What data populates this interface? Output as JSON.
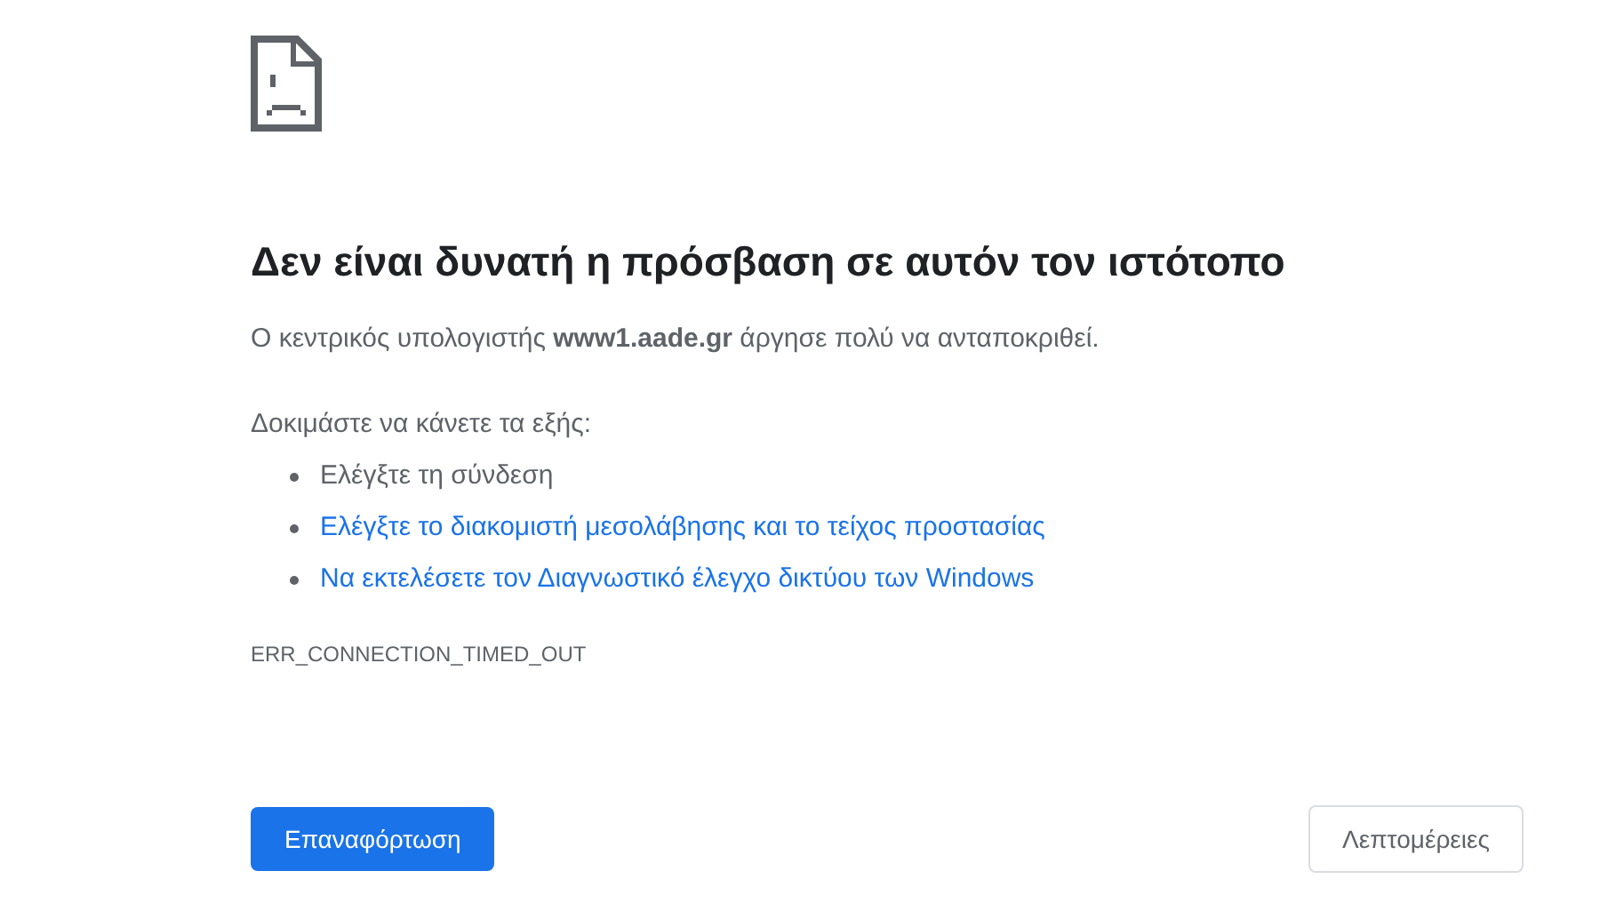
{
  "heading": "Δεν είναι δυνατή η πρόσβαση σε αυτόν τον ιστότοπο",
  "message": "Ο κεντρικός υπολογιστής **www1.aade.gr** άργησε πολύ να ανταποκριθεί.",
  "suggestions_intro": "Δοκιμάστε να κάνετε τα εξής:",
  "suggestions": [
    {
      "kind": "text",
      "label": "Ελέγξτε τη σύνδεση"
    },
    {
      "kind": "link",
      "label": "Ελέγξτε το διακομιστή μεσολάβησης και το τείχος προστασίας"
    },
    {
      "kind": "link",
      "label": "Να εκτελέσετε τον Διαγνωστικό έλεγχο δικτύου των Windows"
    }
  ],
  "error_code": "ERR_CONNECTION_TIMED_OUT",
  "buttons": [
    {
      "kind": "primary",
      "label": "Επαναφόρτωση"
    },
    {
      "kind": "secondary",
      "label": "Λεπτομέρειες"
    }
  ]
}
